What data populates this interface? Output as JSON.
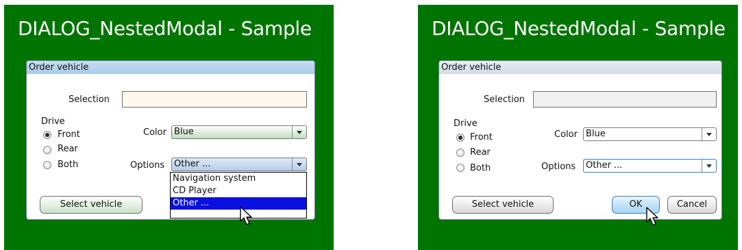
{
  "left": {
    "title": "DIALOG_NestedModal - Sample",
    "dialog": {
      "title": "Order vehicle",
      "selection_label": "Selection",
      "selection_value": "",
      "drive_label": "Drive",
      "drive_options": [
        "Front",
        "Rear",
        "Both"
      ],
      "drive_selected": "Front",
      "color_label": "Color",
      "color_value": "Blue",
      "options_label": "Options",
      "options_value": "Other ...",
      "options_list": [
        "Navigation system",
        "CD Player",
        "Other ..."
      ],
      "options_highlighted": "Other ...",
      "select_button": "Select vehicle"
    }
  },
  "right": {
    "title": "DIALOG_NestedModal - Sample",
    "dialog": {
      "title": "Order vehicle",
      "selection_label": "Selection",
      "selection_value": "",
      "drive_label": "Drive",
      "drive_options": [
        "Front",
        "Rear",
        "Both"
      ],
      "drive_selected": "Front",
      "color_label": "Color",
      "color_value": "Blue",
      "options_label": "Options",
      "options_value": "Other ...",
      "select_button": "Select vehicle",
      "ok_button": "OK",
      "cancel_button": "Cancel"
    }
  },
  "colors": {
    "background": "#007400",
    "dropdown_selection": "#0a10e0"
  }
}
